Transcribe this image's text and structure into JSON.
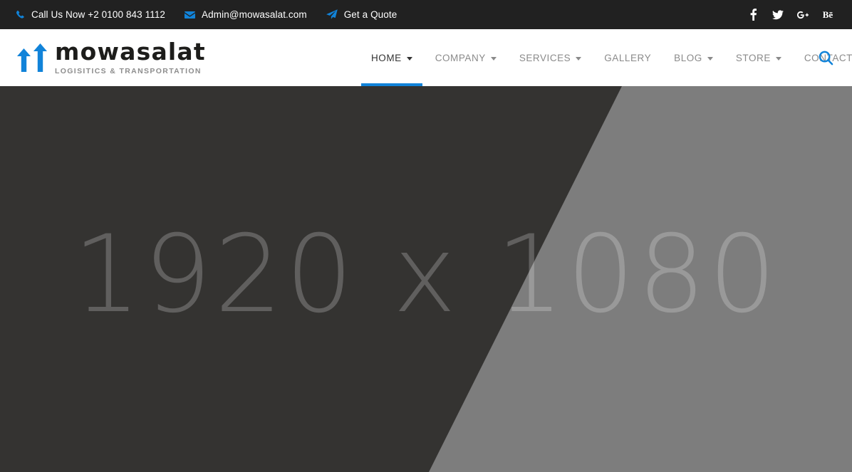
{
  "topbar": {
    "background": "#212121",
    "accent": "#1183d9",
    "items": [
      {
        "icon": "phone-icon",
        "label": "Call Us Now +2 0100 843 1112"
      },
      {
        "icon": "envelope-icon",
        "label": "Admin@mowasalat.com"
      },
      {
        "icon": "paper-plane-icon",
        "label": "Get a Quote"
      }
    ],
    "socials": [
      {
        "icon": "facebook-icon",
        "label": "f"
      },
      {
        "icon": "twitter-icon",
        "label": ""
      },
      {
        "icon": "google-plus-icon",
        "label": "g+"
      },
      {
        "icon": "behance-icon",
        "label": "Bē"
      }
    ]
  },
  "header": {
    "logo": {
      "word": "mowasalat",
      "tagline": "LOGISITICS & TRANSPORTATION",
      "arrow_color": "#1183d9"
    },
    "nav": [
      {
        "label": "HOME",
        "caret": true,
        "active": true
      },
      {
        "label": "COMPANY",
        "caret": true,
        "active": false
      },
      {
        "label": "SERVICES",
        "caret": true,
        "active": false
      },
      {
        "label": "GALLERY",
        "caret": false,
        "active": false
      },
      {
        "label": "BLOG",
        "caret": true,
        "active": false
      },
      {
        "label": "STORE",
        "caret": true,
        "active": false
      },
      {
        "label": "CONTACT",
        "caret": false,
        "active": false
      }
    ],
    "search_icon": "search-icon",
    "active_indicator_color": "#1183d9"
  },
  "hero": {
    "placeholder_text": "1920 x 1080",
    "dark_color": "#343331",
    "light_color": "#7d7d7d"
  }
}
